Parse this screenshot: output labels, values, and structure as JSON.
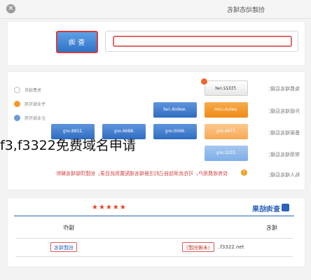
{
  "window": {
    "title": "创建动态域名",
    "close_glyph": "✕"
  },
  "search": {
    "button_label": "查 询",
    "input_value": "",
    "input_placeholder": ""
  },
  "legend": [
    {
      "label": "免费域名",
      "icon": "circle-outline-icon"
    },
    {
      "label": "专业版可用",
      "icon": "orange-circle-icon",
      "color": "#f39a2b"
    },
    {
      "label": "企业版可用",
      "icon": "blue-circle-icon",
      "color": "#6b9bd5"
    }
  ],
  "rows": [
    {
      "label": "免费域名后缀：",
      "tiles": [
        {
          "text": ".f3322.net",
          "style": "white"
        }
      ]
    },
    {
      "label": "升级域名后缀：",
      "tiles": [
        {
          "text": ".eatuo.com",
          "style": "orange"
        },
        {
          "text": ".webok.net",
          "style": "blue"
        }
      ]
    },
    {
      "label": "备案域名后缀：",
      "tiles": [
        {
          "text": ".7766.org",
          "style": "orange-light"
        },
        {
          "text": ".6600.org",
          "style": "blue"
        },
        {
          "text": ".8866.org",
          "style": "blue"
        },
        {
          "text": ".2288.org",
          "style": "blue"
        }
      ]
    },
    {
      "label": "常用域名后缀：",
      "tiles": [
        {
          "text": ".3322.org",
          "style": "blue-light"
        }
      ]
    }
  ],
  "notice": {
    "label": "私人域名后缀：",
    "text": "仅有收费用户，可在此添加自己的注册域名或配置到此目录，创建顶级域名解析"
  },
  "overlay": {
    "text": "f3,f3322免费域名申请"
  },
  "results": {
    "stars": "★★★★★",
    "title": "查询结果",
    "columns": {
      "domain": "域名",
      "action": "操作"
    },
    "row": {
      "domain": "..f3322.net",
      "status": "(未被创建)",
      "action": "创建域名"
    }
  },
  "colors": {
    "accent_blue": "#2a62b8",
    "highlight_red": "#e05555",
    "orange": "#f39a2b"
  }
}
